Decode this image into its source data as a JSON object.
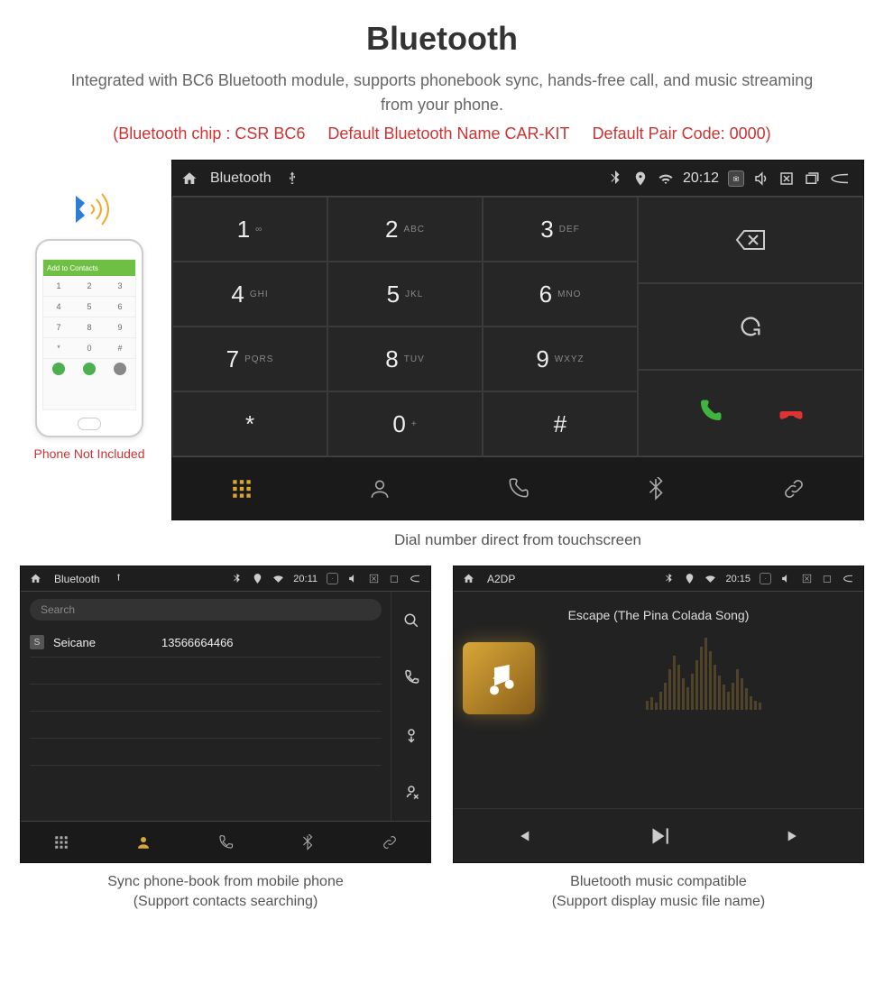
{
  "page": {
    "title": "Bluetooth",
    "subtitle": "Integrated with BC6 Bluetooth module, supports phonebook sync, hands-free call, and music streaming from your phone.",
    "spec_chip": "(Bluetooth chip : CSR BC6",
    "spec_name": "Default Bluetooth Name CAR-KIT",
    "spec_code": "Default Pair Code: 0000)",
    "phone_caption": "Phone Not Included",
    "main_caption": "Dial number direct from touchscreen",
    "left_caption_1": "Sync phone-book from mobile phone",
    "left_caption_2": "(Support contacts searching)",
    "right_caption_1": "Bluetooth music compatible",
    "right_caption_2": "(Support display music file name)"
  },
  "phone_mock": {
    "header": "Add to Contacts",
    "keys": [
      "1",
      "2",
      "3",
      "4",
      "5",
      "6",
      "7",
      "8",
      "9",
      "*",
      "0",
      "#"
    ]
  },
  "main_unit": {
    "title": "Bluetooth",
    "time": "20:12",
    "keys": [
      {
        "num": "1",
        "sub": "∞"
      },
      {
        "num": "2",
        "sub": "ABC"
      },
      {
        "num": "3",
        "sub": "DEF"
      },
      {
        "num": "4",
        "sub": "GHI"
      },
      {
        "num": "5",
        "sub": "JKL"
      },
      {
        "num": "6",
        "sub": "MNO"
      },
      {
        "num": "7",
        "sub": "PQRS"
      },
      {
        "num": "8",
        "sub": "TUV"
      },
      {
        "num": "9",
        "sub": "WXYZ"
      },
      {
        "num": "*",
        "sub": ""
      },
      {
        "num": "0",
        "sub": "+"
      },
      {
        "num": "#",
        "sub": ""
      }
    ]
  },
  "phonebook_unit": {
    "title": "Bluetooth",
    "time": "20:11",
    "search_placeholder": "Search",
    "contact_badge": "S",
    "contact_name": "Seicane",
    "contact_number": "13566664466"
  },
  "a2dp_unit": {
    "title": "A2DP",
    "time": "20:15",
    "track": "Escape (The Pina Colada Song)"
  }
}
